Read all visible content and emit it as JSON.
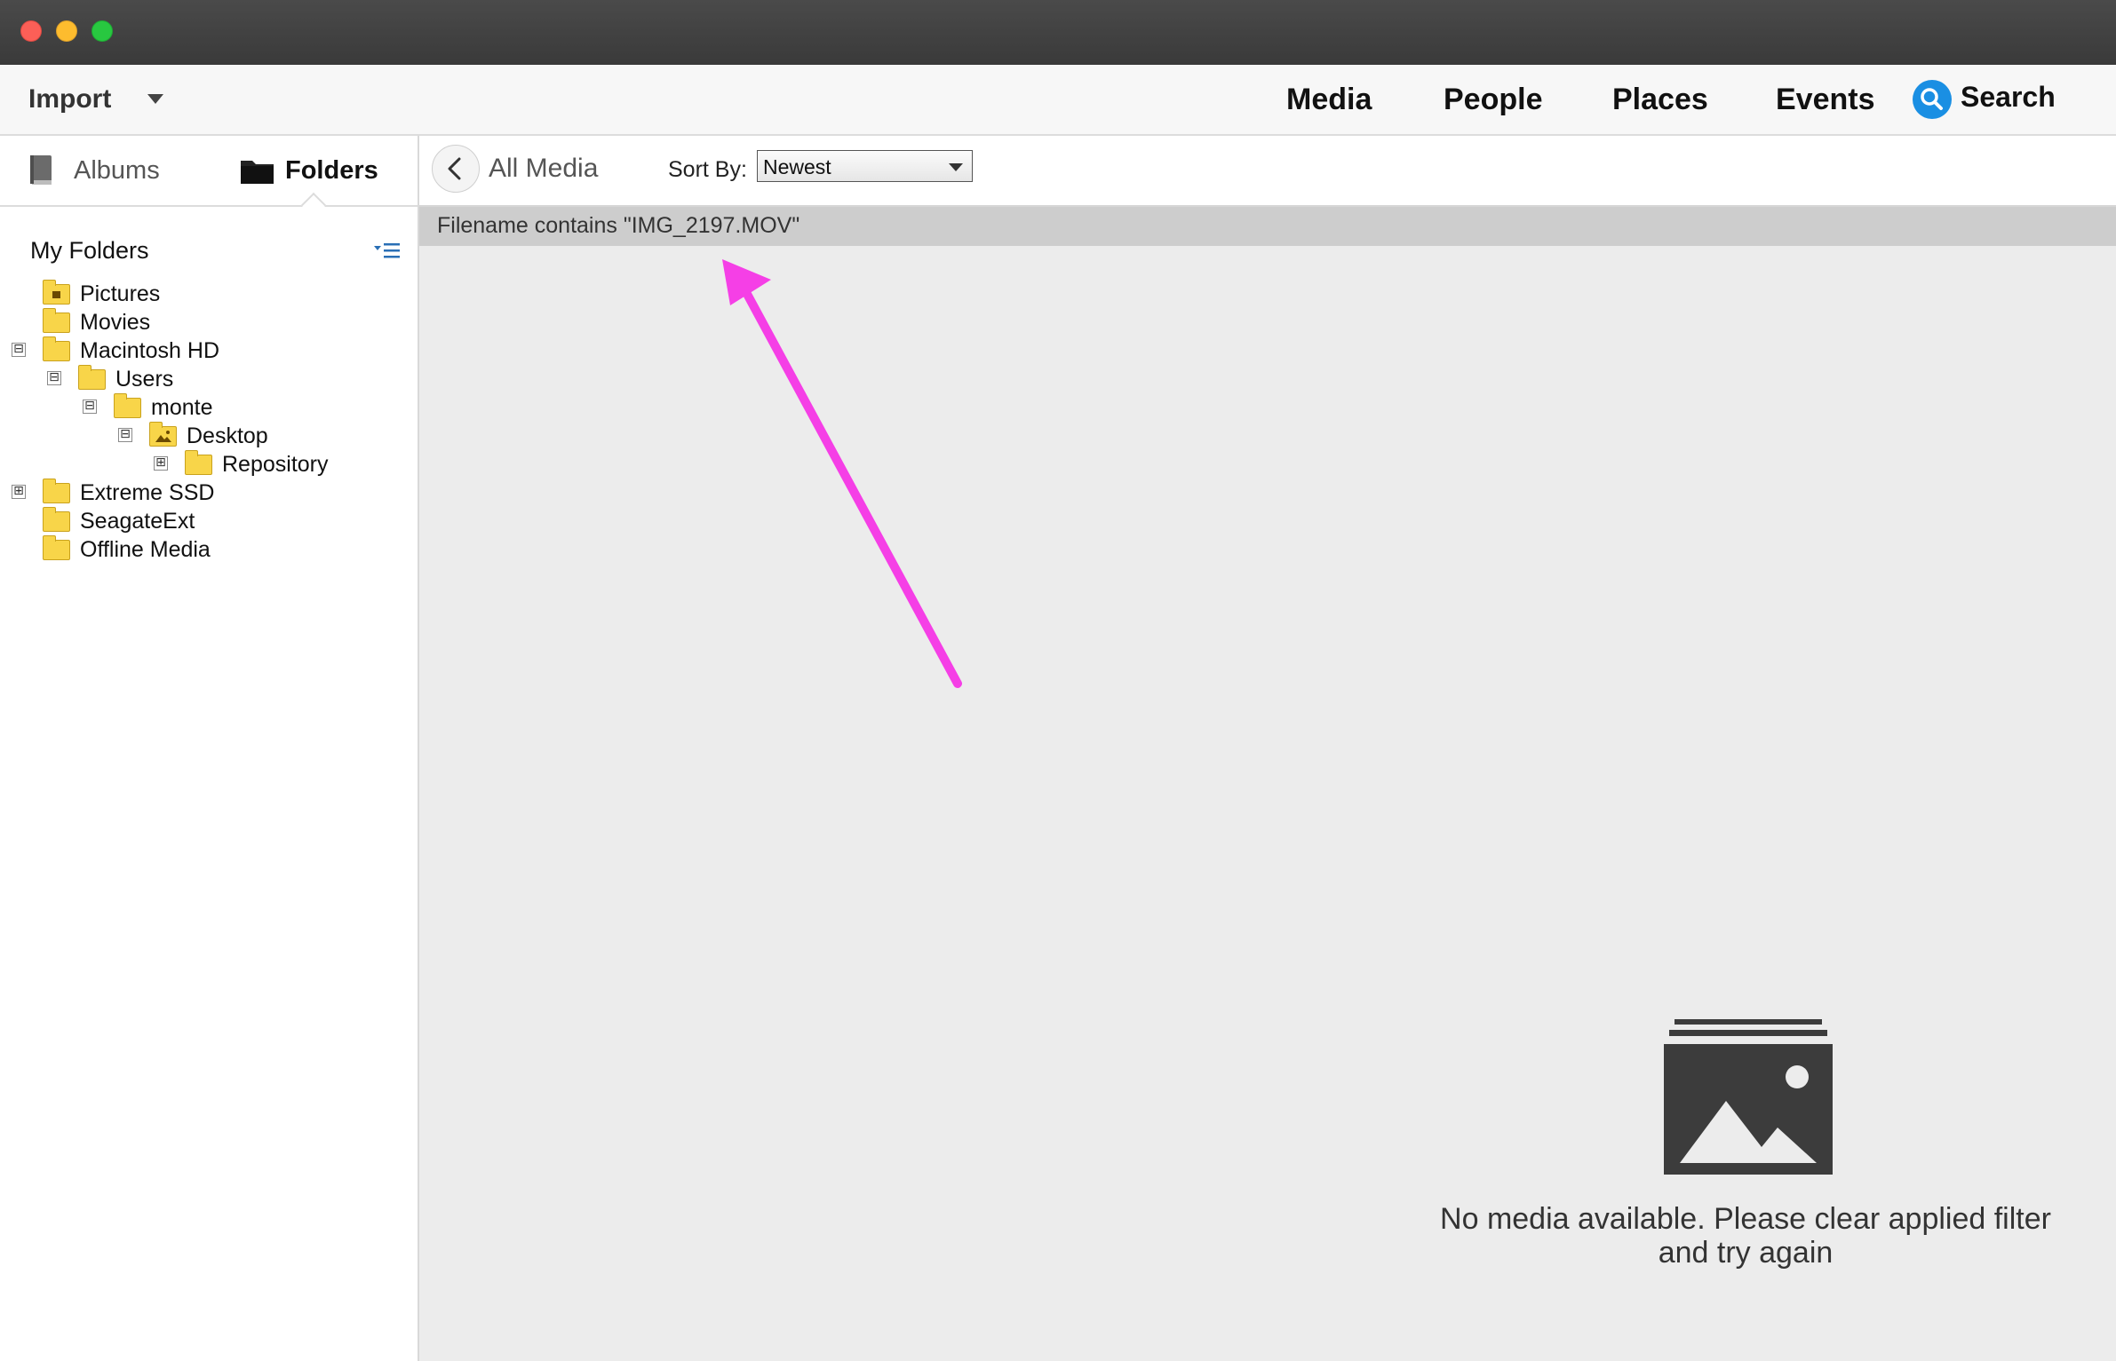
{
  "window": {
    "controls": [
      "close",
      "minimize",
      "zoom"
    ]
  },
  "toolbar": {
    "import_label": "Import",
    "nav": [
      "Media",
      "People",
      "Places",
      "Events"
    ],
    "search_label": "Search",
    "accent_color": "#1a8fe3"
  },
  "sidebar": {
    "tabs": {
      "albums": "Albums",
      "folders": "Folders"
    },
    "section_title": "My Folders",
    "tree": [
      {
        "label": "Pictures",
        "level": 0,
        "icon": "pictures-folder-icon"
      },
      {
        "label": "Movies",
        "level": 0,
        "icon": "folder-icon"
      },
      {
        "label": "Macintosh HD",
        "level": 0,
        "icon": "folder-icon",
        "expander": "⊟"
      },
      {
        "label": "Users",
        "level": 1,
        "icon": "folder-icon",
        "expander": "⊟"
      },
      {
        "label": "monte",
        "level": 2,
        "icon": "folder-icon",
        "expander": "⊟"
      },
      {
        "label": "Desktop",
        "level": 3,
        "icon": "desktop-folder-icon",
        "expander": "⊟"
      },
      {
        "label": "Repository",
        "level": 4,
        "icon": "folder-icon",
        "expander": "⊞"
      },
      {
        "label": "Extreme SSD",
        "level": 0,
        "icon": "folder-icon",
        "expander": "⊞"
      },
      {
        "label": "SeagateExt",
        "level": 0,
        "icon": "folder-icon"
      },
      {
        "label": "Offline Media",
        "level": 0,
        "icon": "folder-icon"
      }
    ]
  },
  "content": {
    "header": {
      "back_label": "All Media",
      "sort_label": "Sort By:",
      "sort_value": "Newest"
    },
    "filter_text": "Filename contains \"IMG_2197.MOV\"",
    "empty_message_line1": "No media available. Please clear applied filter",
    "empty_message_line2": "and try again",
    "annotation_color": "#f53fe6"
  }
}
